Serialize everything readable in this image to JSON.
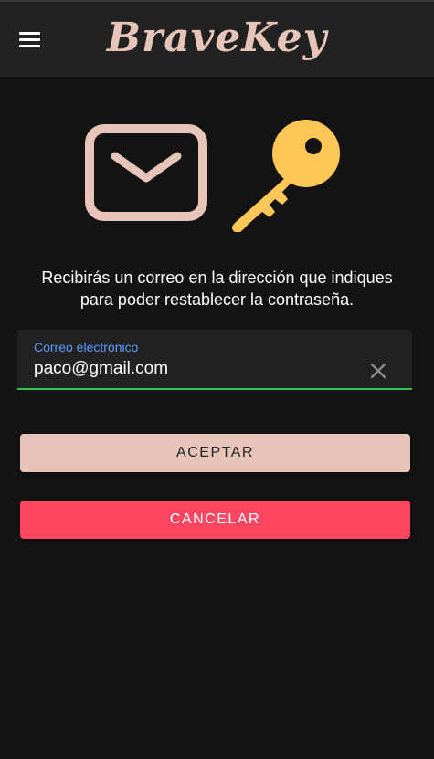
{
  "app": {
    "title": "BraveKey"
  },
  "header": {
    "menu_icon": "hamburger-menu-icon"
  },
  "illustration": {
    "mail_icon": "envelope-icon",
    "key_icon": "key-icon",
    "mail_color": "#e6c4b8",
    "key_color": "#ffc658"
  },
  "description": {
    "line1": "Recibirás un correo en la dirección que indiques",
    "line2": "para poder restablecer la contraseña."
  },
  "email_field": {
    "label": "Correo electrónico",
    "value": "paco@gmail.com",
    "clear_icon": "close-icon"
  },
  "buttons": {
    "accept_label": "ACEPTAR",
    "cancel_label": "CANCELAR"
  },
  "colors": {
    "accent_pink": "#e6c4b8",
    "danger": "#ff4660",
    "focus_green": "#2fc25b",
    "label_blue": "#5a9cff",
    "background": "#131313",
    "header": "#222222"
  }
}
